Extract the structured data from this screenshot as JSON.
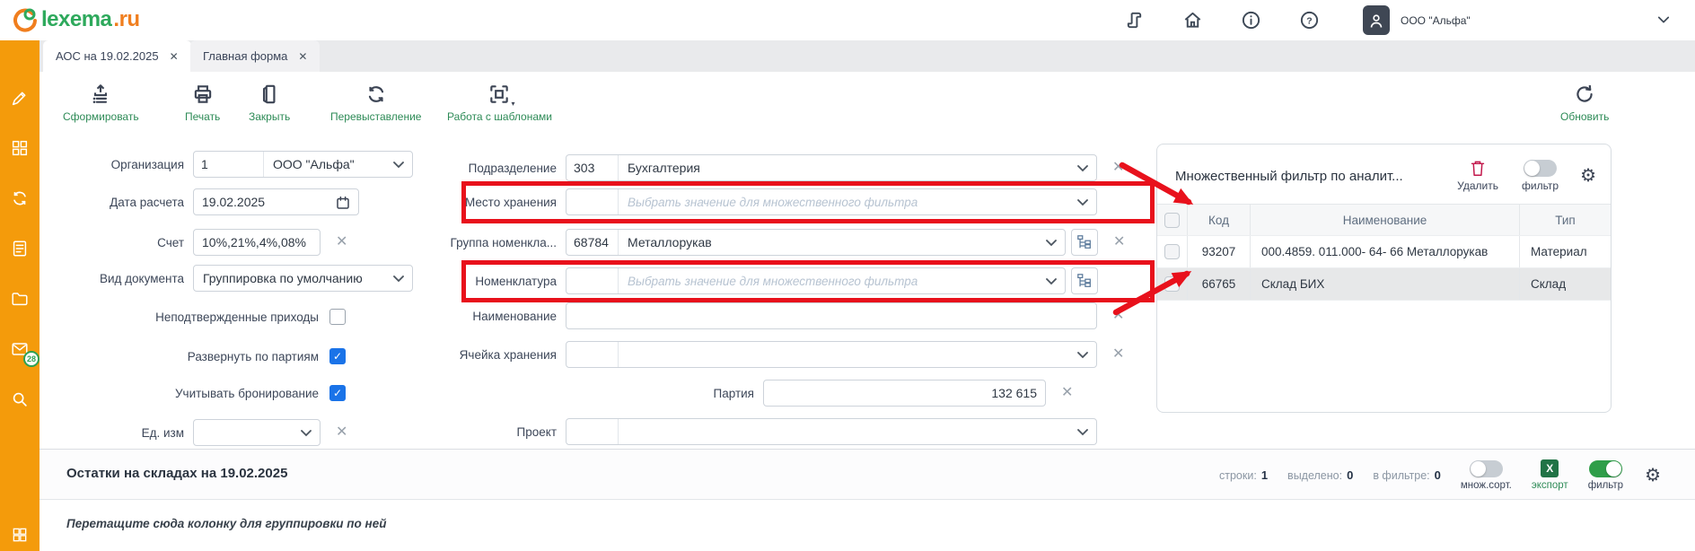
{
  "header": {
    "company": "ООО \"Альфа\""
  },
  "logo": {
    "text": "lexema",
    "suffix": ".ru"
  },
  "tabs": [
    {
      "label": "АОС на 19.02.2025"
    },
    {
      "label": "Главная форма"
    }
  ],
  "toolbar": {
    "generate": "Сформировать",
    "print": "Печать",
    "close": "Закрыть",
    "reissue": "Перевыставление",
    "templates": "Работа с шаблонами",
    "refresh": "Обновить"
  },
  "form": {
    "organization": {
      "label": "Организация",
      "code": "1",
      "value": "ООО \"Альфа\""
    },
    "calc_date": {
      "label": "Дата расчета",
      "value": "19.02.2025"
    },
    "account": {
      "label": "Счет",
      "value": "10%,21%,4%,08%"
    },
    "doc_type": {
      "label": "Вид документа",
      "value": "Группировка по умолчанию"
    },
    "unconfirmed": {
      "label": "Неподтвержденные приходы",
      "checked": false
    },
    "expand_batches": {
      "label": "Развернуть по партиям",
      "checked": true
    },
    "reservation": {
      "label": "Учитывать бронирование",
      "checked": true
    },
    "unit": {
      "label": "Ед. изм",
      "value": ""
    },
    "department": {
      "label": "Подразделение",
      "code": "303",
      "value": "Бухгалтерия"
    },
    "storage_place": {
      "label": "Место хранения",
      "code": "",
      "placeholder": "Выбрать значение для множественного фильтра"
    },
    "nomen_group": {
      "label": "Группа номенкла...",
      "code": "68784",
      "value": "Металлорукав"
    },
    "nomenclature": {
      "label": "Номенклатура",
      "code": "",
      "placeholder": "Выбрать значение для множественного фильтра"
    },
    "name": {
      "label": "Наименование",
      "value": ""
    },
    "storage_cell": {
      "label": "Ячейка хранения",
      "code": "",
      "value": ""
    },
    "batch": {
      "label": "Партия",
      "value": "132 615"
    },
    "project": {
      "label": "Проект",
      "code": "",
      "value": ""
    }
  },
  "filter_panel": {
    "title": "Множественный фильтр по аналит...",
    "delete_label": "Удалить",
    "filter_label": "фильтр",
    "table": {
      "headers": {
        "code": "Код",
        "name": "Наименование",
        "type": "Тип"
      },
      "rows": [
        {
          "code": "93207",
          "name": "000.4859. 011.000- 64- 66 Металлорукав",
          "type": "Материал"
        },
        {
          "code": "66765",
          "name": "Склад БИХ",
          "type": "Склад"
        }
      ]
    }
  },
  "grid": {
    "title": "Остатки на складах на 19.02.2025",
    "rows_label": "строки:",
    "rows_value": "1",
    "selected_label": "выделено:",
    "selected_value": "0",
    "filtered_label": "в фильтре:",
    "filtered_value": "0",
    "multisort_label": "множ.сорт.",
    "export_label": "экспорт",
    "filter_label": "фильтр",
    "drag_hint": "Перетащите сюда колонку для группировки по ней"
  },
  "sidebar": {
    "mail_badge": "28"
  },
  "icons": {
    "gear": "⚙",
    "close": "✕",
    "clear": "✕",
    "excel": "X"
  },
  "colors": {
    "sidebar_orange": "#F49B0B",
    "brand_green": "#2EA95C",
    "brand_orange": "#F07E1E",
    "action_green": "#2E8B57",
    "highlight_red": "#E8111C",
    "checkbox_blue": "#1A73E8",
    "toggle_green": "#2F9E49",
    "excel_green": "#217346",
    "trash_red": "#C2174B"
  }
}
